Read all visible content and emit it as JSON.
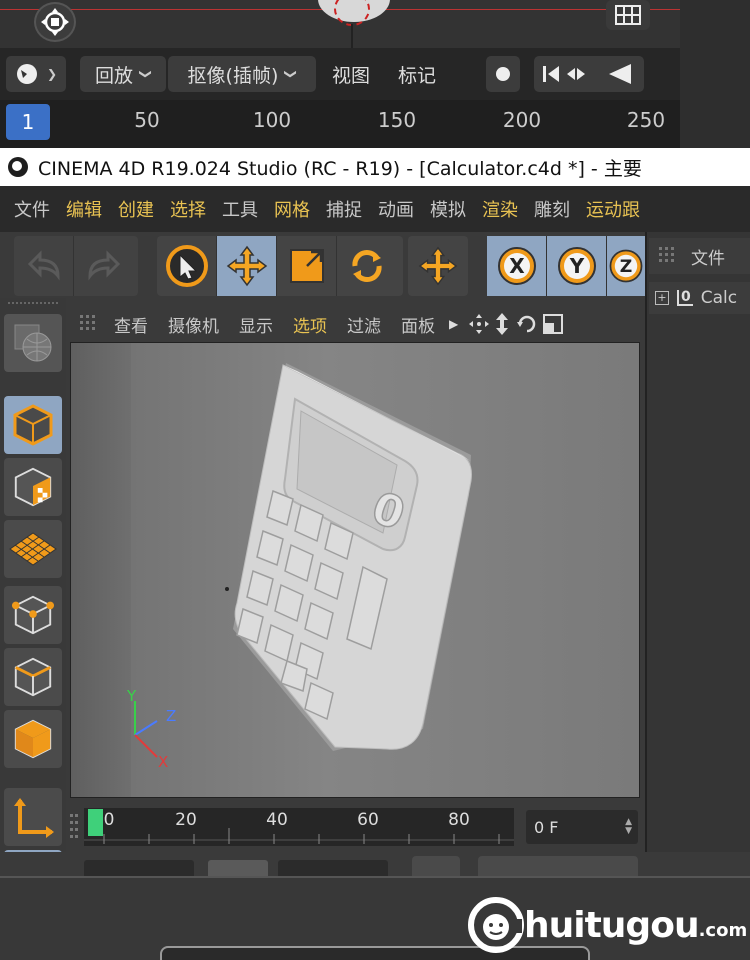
{
  "top": {
    "menus": [
      {
        "label": "回放"
      },
      {
        "label": "抠像(插帧)"
      },
      {
        "label": "视图"
      },
      {
        "label": "标记"
      }
    ],
    "ruler": {
      "current": "1",
      "ticks": [
        "50",
        "100",
        "150",
        "200",
        "250"
      ]
    }
  },
  "window": {
    "title": "CINEMA 4D R19.024 Studio (RC - R19) - [Calculator.c4d *] - 主要"
  },
  "menubar": {
    "items": [
      {
        "label": "文件",
        "highlight": false
      },
      {
        "label": "编辑",
        "highlight": true
      },
      {
        "label": "创建",
        "highlight": true
      },
      {
        "label": "选择",
        "highlight": true
      },
      {
        "label": "工具",
        "highlight": false
      },
      {
        "label": "网格",
        "highlight": true
      },
      {
        "label": "捕捉",
        "highlight": false
      },
      {
        "label": "动画",
        "highlight": false
      },
      {
        "label": "模拟",
        "highlight": false
      },
      {
        "label": "渲染",
        "highlight": true
      },
      {
        "label": "雕刻",
        "highlight": false
      },
      {
        "label": "运动跟",
        "highlight": true
      }
    ]
  },
  "viewport": {
    "menus": [
      {
        "label": "查看",
        "highlight": false
      },
      {
        "label": "摄像机",
        "highlight": false
      },
      {
        "label": "显示",
        "highlight": false
      },
      {
        "label": "选项",
        "highlight": true
      },
      {
        "label": "过滤",
        "highlight": false
      },
      {
        "label": "面板",
        "highlight": false
      }
    ],
    "axis": {
      "x": "X",
      "y": "Y",
      "z": "Z"
    },
    "display_digit": "0"
  },
  "object_manager": {
    "header": "文件",
    "layer_num": "0",
    "object_name": "Calc"
  },
  "timeline": {
    "ticks": [
      "0",
      "20",
      "40",
      "60",
      "80"
    ],
    "frame_field": "0 F"
  },
  "colors": {
    "accent_blue": "#8fa6c2",
    "highlight_text": "#e8c252",
    "orange": "#f09a1a",
    "timeline_marker": "#3fd07a"
  },
  "watermark": {
    "brand": "huitugou",
    "suffix": ".com",
    "initial": "C"
  }
}
